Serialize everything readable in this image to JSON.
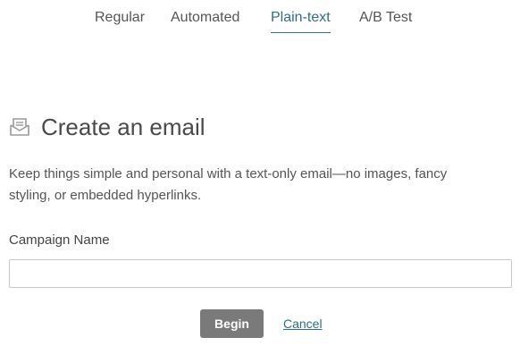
{
  "tabs": [
    {
      "label": "Regular",
      "active": false
    },
    {
      "label": "Automated",
      "active": false
    },
    {
      "label": "Plain-text",
      "active": true
    },
    {
      "label": "A/B Test",
      "active": false
    }
  ],
  "heading": {
    "icon": "envelope-icon",
    "title": "Create an email"
  },
  "description": "Keep things simple and personal with a text-only email—no images, fancy styling, or embedded hyperlinks.",
  "form": {
    "campaign_name_label": "Campaign Name",
    "campaign_name_value": "",
    "campaign_name_placeholder": ""
  },
  "actions": {
    "begin_label": "Begin",
    "cancel_label": "Cancel"
  },
  "colors": {
    "accent": "#2f6f7e",
    "button_bg": "#7a7a7a",
    "text": "#555555"
  }
}
